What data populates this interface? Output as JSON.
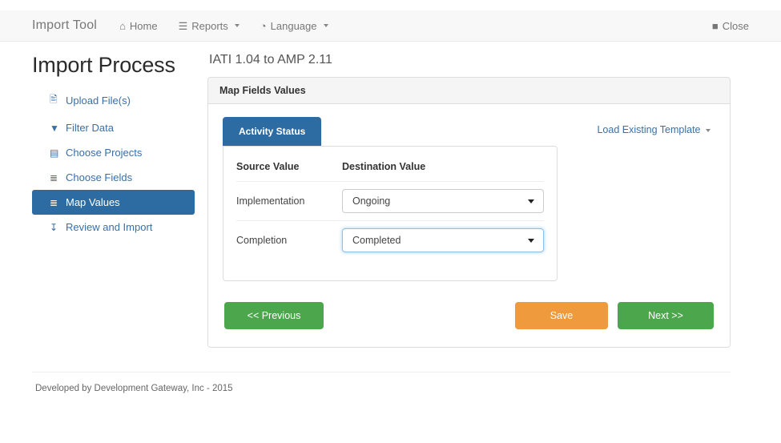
{
  "navbar": {
    "brand": "Import Tool",
    "items": [
      {
        "label": "Home",
        "icon": "home-icon",
        "glyph": "⌂",
        "caret": false
      },
      {
        "label": "Reports",
        "icon": "list-icon",
        "glyph": "☰",
        "caret": true
      },
      {
        "label": "Language",
        "icon": "globe-icon",
        "glyph": "◔",
        "caret": true
      }
    ],
    "close": {
      "label": "Close",
      "icon": "stop-square-icon",
      "glyph": "■"
    }
  },
  "sidebar": {
    "title": "Import Process",
    "items": [
      {
        "label": "Upload File(s)",
        "icon": "file-icon",
        "glyph": "὜b",
        "active": false
      },
      {
        "label": "Filter Data",
        "icon": "filter-icon",
        "glyph": "▼",
        "active": false
      },
      {
        "label": "Choose Projects",
        "icon": "table-icon",
        "glyph": "▤",
        "active": false
      },
      {
        "label": "Choose Fields",
        "icon": "list-alt-icon",
        "glyph": "≣",
        "active": false
      },
      {
        "label": "Map Values",
        "icon": "tasks-icon",
        "glyph": "≣",
        "active": true
      },
      {
        "label": "Review and Import",
        "icon": "download-icon",
        "glyph": "⤓",
        "active": false
      }
    ]
  },
  "main": {
    "subtitle": "IATI 1.04 to AMP 2.11",
    "panel_title": "Map Fields Values",
    "tab_label": "Activity Status",
    "template_link": "Load Existing Template",
    "table": {
      "headers": [
        "Source Value",
        "Destination Value"
      ],
      "rows": [
        {
          "source": "Implementation",
          "destination": "Ongoing",
          "focused": false
        },
        {
          "source": "Completion",
          "destination": "Completed",
          "focused": true
        }
      ]
    },
    "buttons": {
      "previous": "<< Previous",
      "save": "Save",
      "next": "Next >>"
    }
  },
  "footer": {
    "text": "Developed by Development Gateway, Inc - 2015"
  },
  "colors": {
    "brand_blue": "#2d6ca2",
    "link_blue": "#3a6fa8",
    "green": "#4ca64c",
    "orange": "#ef9a3d",
    "navbar_bg": "#f8f8f8",
    "panel_head_bg": "#f5f5f5"
  }
}
